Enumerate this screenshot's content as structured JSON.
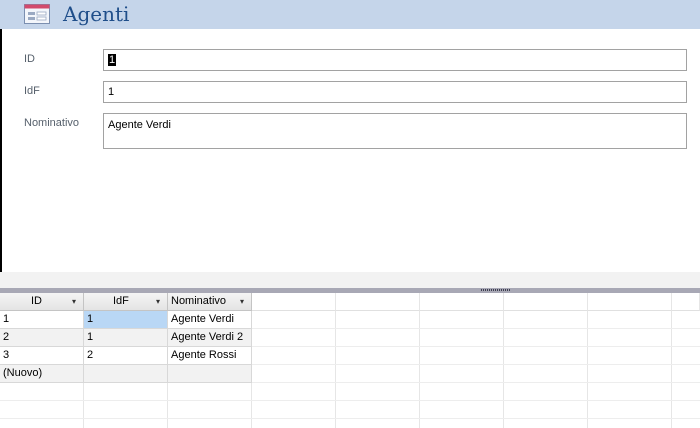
{
  "form": {
    "title": "Agenti",
    "fields": [
      {
        "label": "ID",
        "value": "1"
      },
      {
        "label": "IdF",
        "value": "1"
      },
      {
        "label": "Nominativo",
        "value": "Agente Verdi"
      }
    ]
  },
  "datasheet": {
    "columns": [
      "ID",
      "IdF",
      "Nominativo"
    ],
    "sort_arrow": "▾",
    "rows": [
      [
        "1",
        "1",
        "Agente Verdi"
      ],
      [
        "2",
        "1",
        "Agente Verdi 2"
      ],
      [
        "3",
        "2",
        "Agente Rossi"
      ]
    ],
    "new_row_label": "(Nuovo)"
  },
  "colors": {
    "header_bg": "#c5d5ea",
    "title_color": "#1f4e8a",
    "selection": "#b9d7f5"
  },
  "icons": {
    "form_icon": "form-icon",
    "splitter_grip": "splitter-grip-icon"
  }
}
